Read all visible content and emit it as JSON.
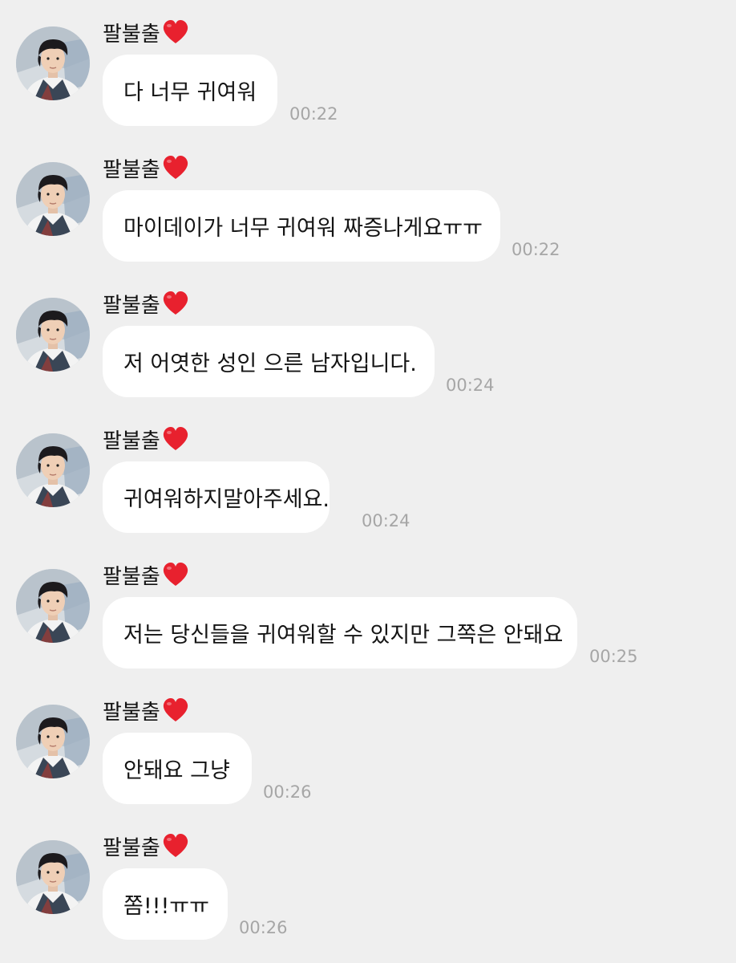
{
  "colors": {
    "background": "#efefef",
    "bubble": "#ffffff",
    "text": "#141414",
    "timestamp": "#a6a6a6",
    "heart": "#e8212e"
  },
  "messages": [
    {
      "sender": "팔불출",
      "sender_icon": "heart-icon",
      "text": "다 너무 귀여워",
      "time": "00:22"
    },
    {
      "sender": "팔불출",
      "sender_icon": "heart-icon",
      "text": "마이데이가 너무 귀여워 짜증나게요ㅠㅠ",
      "time": "00:22"
    },
    {
      "sender": "팔불출",
      "sender_icon": "heart-icon",
      "text": "저 어엿한 성인 으른 남자입니다.",
      "time": "00:24"
    },
    {
      "sender": "팔불출",
      "sender_icon": "heart-icon",
      "text": "귀여워하지말아주세요.",
      "time": "00:24"
    },
    {
      "sender": "팔불출",
      "sender_icon": "heart-icon",
      "text": "저는 당신들을 귀여워할 수 있지만 그쪽은 안돼요",
      "time": "00:25"
    },
    {
      "sender": "팔불출",
      "sender_icon": "heart-icon",
      "text": "안돼요 그냥",
      "time": "00:26"
    },
    {
      "sender": "팔불출",
      "sender_icon": "heart-icon",
      "text": "쫌!!!ㅠㅠ",
      "time": "00:26"
    }
  ]
}
